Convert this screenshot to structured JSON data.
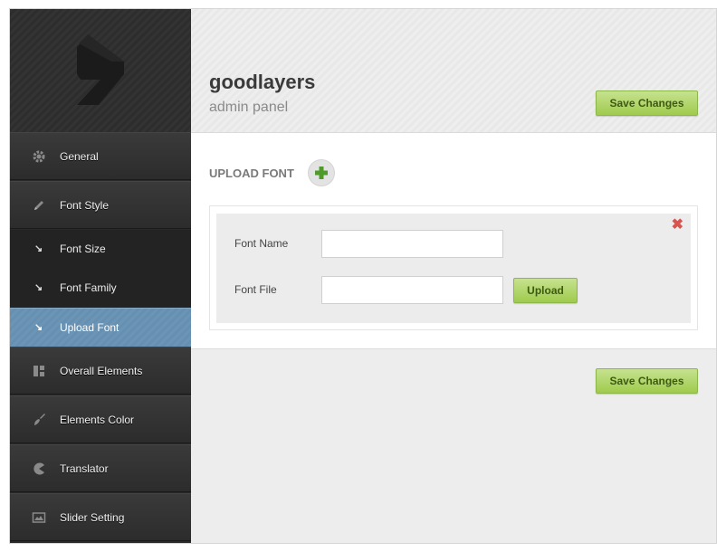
{
  "sidebar": {
    "logo_icon": "goodlayers-logo-icon",
    "items": [
      {
        "label": "General",
        "icon": "gear-icon"
      },
      {
        "label": "Font Style",
        "icon": "pencil-icon"
      },
      {
        "label": "Overall Elements",
        "icon": "layout-icon"
      },
      {
        "label": "Elements Color",
        "icon": "brush-icon"
      },
      {
        "label": "Translator",
        "icon": "pacman-icon"
      },
      {
        "label": "Slider Setting",
        "icon": "slides-icon"
      }
    ],
    "sub_items": [
      {
        "label": "Font Size",
        "icon": "arrow-down-right-icon"
      },
      {
        "label": "Font Family",
        "icon": "arrow-down-right-icon"
      },
      {
        "label": "Upload Font",
        "icon": "arrow-down-right-icon",
        "active": true
      }
    ]
  },
  "header": {
    "brand": "goodlayers",
    "subtitle": "admin panel",
    "save_label": "Save Changes"
  },
  "content": {
    "section_title": "UPLOAD FONT",
    "add_icon": "plus-icon",
    "close_icon": "close-icon",
    "font_name_label": "Font Name",
    "font_name_value": "",
    "font_file_label": "Font File",
    "font_file_value": "",
    "upload_label": "Upload"
  },
  "footer": {
    "save_label": "Save Changes"
  },
  "colors": {
    "sidebar_bg": "#2a2a2a",
    "active_item": "#6b94b5",
    "button_green": "#a8d05c",
    "close_red": "#d9534f"
  }
}
